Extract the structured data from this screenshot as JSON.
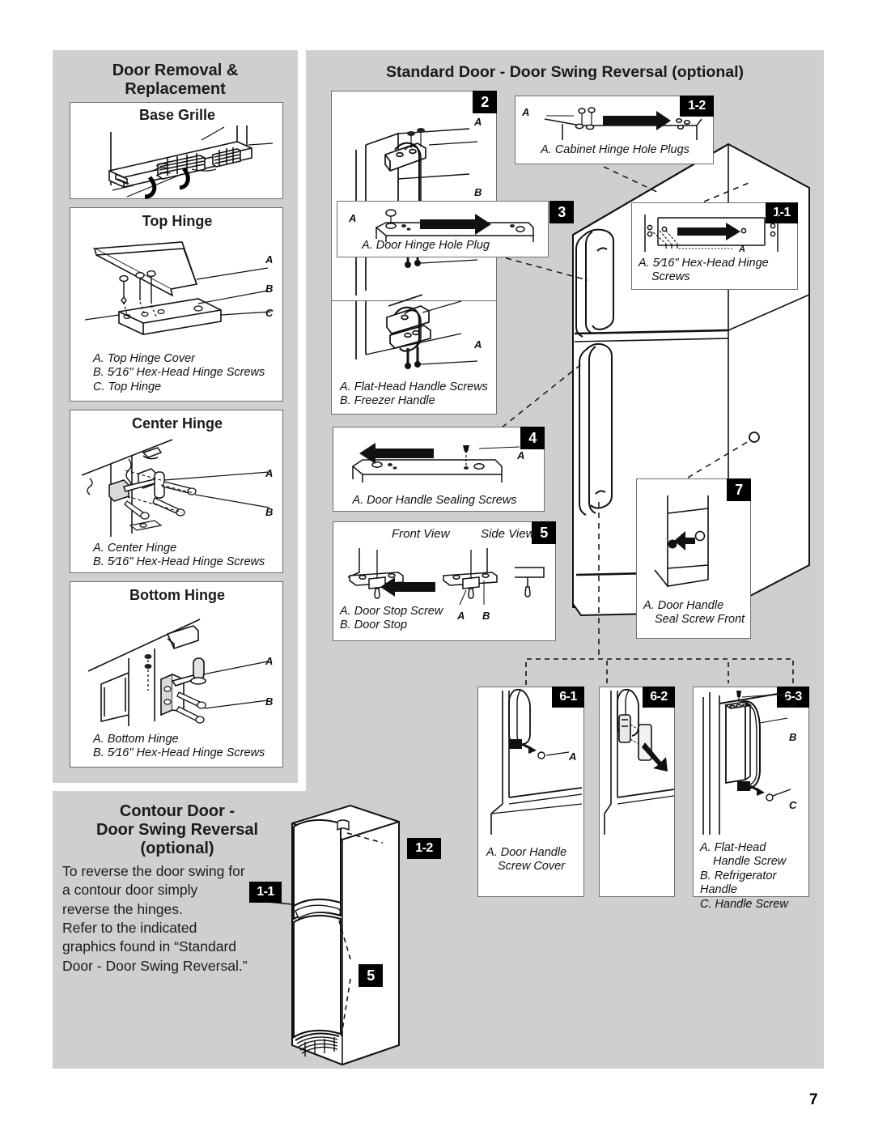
{
  "page": {
    "number": "7"
  },
  "left_section": {
    "title_line1": "Door Removal &",
    "title_line2": "Replacement",
    "panels": {
      "base_grille": {
        "title": "Base Grille"
      },
      "top_hinge": {
        "title": "Top Hinge",
        "labels": [
          "A",
          "B",
          "C"
        ],
        "captions": [
          "A. Top Hinge Cover",
          "B. 5⁄16\" Hex-Head Hinge Screws",
          "C. Top Hinge"
        ]
      },
      "center_hinge": {
        "title": "Center Hinge",
        "labels": [
          "A",
          "B"
        ],
        "captions": [
          "A. Center Hinge",
          "B. 5⁄16\" Hex-Head Hinge Screws"
        ]
      },
      "bottom_hinge": {
        "title": "Bottom Hinge",
        "labels": [
          "A",
          "B"
        ],
        "captions": [
          "A. Bottom Hinge",
          "B. 5⁄16\" Hex-Head Hinge Screws"
        ]
      }
    }
  },
  "right_section": {
    "title": "Standard Door - Door Swing Reversal (optional)",
    "panels": {
      "p2": {
        "badge": "2",
        "labels": [
          "A",
          "B"
        ]
      },
      "p1_2": {
        "badge": "1-2",
        "label_a": "A",
        "caption": "A. Cabinet Hinge Hole Plugs"
      },
      "p3": {
        "badge": "3",
        "label_a": "A",
        "caption": "A. Door Hinge Hole Plug"
      },
      "p1_1": {
        "badge": "1-1",
        "label_a": "A",
        "caption_line1": "A. 5⁄16\" Hex-Head Hinge",
        "caption_line2": "Screws"
      },
      "handle": {
        "label_a": "A",
        "caption_line1": "A. Flat-Head Handle Screws",
        "caption_line2": "B. Freezer Handle"
      },
      "p4": {
        "badge": "4",
        "label_a": "A",
        "caption": "A. Door Handle Sealing Screws"
      },
      "p5": {
        "badge": "5",
        "view_front": "Front View",
        "view_side": "Side View",
        "label_a": "A",
        "label_b": "B",
        "caption_line1": "A. Door Stop Screw",
        "caption_line2": "B. Door Stop"
      },
      "p7": {
        "badge": "7",
        "caption_line1": "A. Door Handle",
        "caption_line2": "Seal Screw Front"
      },
      "p6_1": {
        "badge": "6-1",
        "label_a": "A",
        "caption_line1": "A. Door Handle",
        "caption_line2": "Screw Cover"
      },
      "p6_2": {
        "badge": "6-2"
      },
      "p6_3": {
        "badge": "6-3",
        "labels": [
          "A",
          "B",
          "C"
        ],
        "caption_line1": "A. Flat-Head",
        "caption_line2": "Handle Screw",
        "caption_line3": "B. Refrigerator Handle",
        "caption_line4": "C. Handle Screw"
      }
    }
  },
  "contour_section": {
    "title_line1": "Contour Door -",
    "title_line2": "Door Swing Reversal",
    "title_line3": "(optional)",
    "paragraph1": "To reverse the door swing for a contour door simply reverse the hinges.",
    "paragraph2": "Refer to the indicated graphics found in “Standard Door - Door Swing Reversal.”",
    "badges": [
      "1-2",
      "1-1",
      "5"
    ]
  }
}
